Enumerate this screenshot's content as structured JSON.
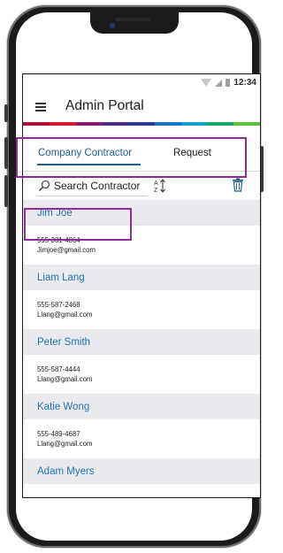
{
  "status": {
    "time": "12:34"
  },
  "header": {
    "title": "Admin Portal"
  },
  "brand_colors": [
    "#b0123b",
    "#d7192d",
    "#8c1b6b",
    "#4d2d80",
    "#2e3a8f",
    "#1e77c3",
    "#14a0c9",
    "#19a86b",
    "#5fbf3a"
  ],
  "tabs": [
    {
      "label": "Company Contractor",
      "active": true
    },
    {
      "label": "Request",
      "active": false
    }
  ],
  "search": {
    "label": "Search Contractor"
  },
  "icons": {
    "menu": "menu-icon",
    "search": "search-icon",
    "sort": "sort-az-icon",
    "delete": "trash-icon"
  },
  "contractors": [
    {
      "name": "Jim Joe",
      "phone": "555-331-4864",
      "email": "Jimjoe@gmail.com"
    },
    {
      "name": "Liam Lang",
      "phone": "555-587-2468",
      "email": "Llang@gmail.com"
    },
    {
      "name": "Peter Smith",
      "phone": "555-587-4444",
      "email": "Llang@gmail.com"
    },
    {
      "name": "Katie Wong",
      "phone": "555-489-4687",
      "email": "Llang@gmail.com"
    },
    {
      "name": "Adam Myers"
    }
  ],
  "highlight_color": "#8f2a9b"
}
